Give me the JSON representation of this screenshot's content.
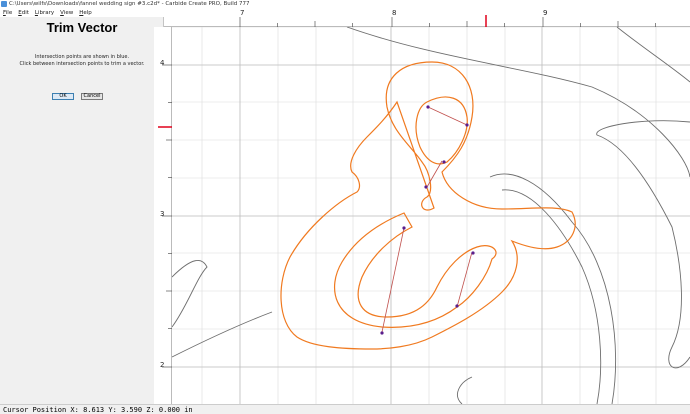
{
  "window": {
    "title": "C:\\Users\\wilfs\\Downloads\\fannel wedding sign #3.c2d* - Carbide Create PRO, Build 777"
  },
  "menu": {
    "items": [
      {
        "accel": "F",
        "rest": "ile"
      },
      {
        "accel": "E",
        "rest": "dit"
      },
      {
        "accel": "L",
        "rest": "ibrary"
      },
      {
        "accel": "V",
        "rest": "iew"
      },
      {
        "accel": "H",
        "rest": "elp"
      }
    ]
  },
  "panel": {
    "title": "Trim Vector",
    "line1": "Intersection points are shown in blue.",
    "line2": "Click between intersection points to trim a vector.",
    "ok_label": "OK",
    "cancel_label": "Cancel"
  },
  "rulers": {
    "top_labels": [
      "7",
      "8",
      "9"
    ],
    "left_labels": [
      "4",
      "3",
      "2"
    ],
    "marker_color": "#e0001b"
  },
  "colors": {
    "vector_selected": "#f07a20",
    "vector_normal": "#6e6e6e",
    "intersection_point": "#5a1e8c",
    "trim_segment": "#c0504d",
    "grid": "#dcdcdc"
  },
  "status": {
    "text": "Cursor Position X: 8.613 Y: 3.590 Z: 0.000 in"
  }
}
